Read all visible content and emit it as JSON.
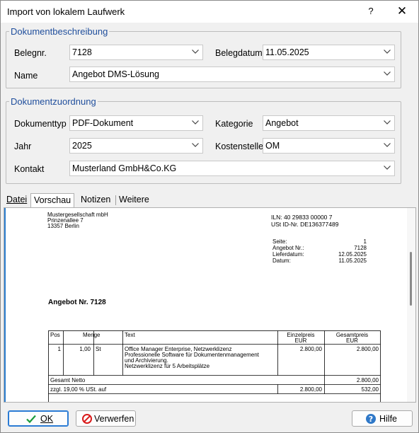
{
  "window": {
    "title": "Import von lokalem Laufwerk",
    "help_glyph": "?",
    "close_glyph": "✕"
  },
  "beschreibung": {
    "legend": "Dokumentbeschreibung",
    "belegnr_label": "Belegnr.",
    "belegnr_value": "7128",
    "belegdatum_label": "Belegdatum",
    "belegdatum_value": "11.05.2025",
    "name_label": "Name",
    "name_value": "Angebot DMS-Lösung"
  },
  "zuordnung": {
    "legend": "Dokumentzuordnung",
    "dokumenttyp_label": "Dokumenttyp",
    "dokumenttyp_value": "PDF-Dokument",
    "kategorie_label": "Kategorie",
    "kategorie_value": "Angebot",
    "jahr_label": "Jahr",
    "jahr_value": "2025",
    "kostenstelle_label": "Kostenstelle",
    "kostenstelle_value": "OM",
    "kontakt_label": "Kontakt",
    "kontakt_value": "Musterland GmbH&Co.KG"
  },
  "tabs": [
    {
      "label": "Datei"
    },
    {
      "label": "Vorschau"
    },
    {
      "label": "Notizen"
    },
    {
      "label": "Weitere"
    }
  ],
  "preview": {
    "sender_1": "Mustergesellschaft mbH",
    "sender_2": "Prinzenallee 7",
    "sender_3": "13357 Berlin",
    "iln": "ILN: 40 29833 00000 7",
    "ustid": "USt ID-Nr. DE136377489",
    "seite_label": "Seite:",
    "seite_value": "1",
    "angebotnr_label": "Angebot Nr.:",
    "angebotnr_value": "7128",
    "lieferdatum_label": "Lieferdatum:",
    "lieferdatum_value": "12.05.2025",
    "datum_label": "Datum:",
    "datum_value": "11.05.2025",
    "heading": "Angebot Nr. 7128",
    "col_pos": "Pos",
    "col_menge": "Menge",
    "col_text": "Text",
    "col_einzel_1": "Einzelpreis",
    "col_einzel_2": "EUR",
    "col_gesamt_1": "Gesamtpreis",
    "col_gesamt_2": "EUR",
    "row_pos": "1",
    "row_menge": "1,00",
    "row_unit": "St",
    "row_text_1": "Office Manager Enterprise, Netzwerklizenz",
    "row_text_2": "Professionelle Software für Dokumentenmanagement",
    "row_text_3": "und Archivierung.",
    "row_text_4": "Netzwerklizenz für 5 Arbeitsplätze",
    "row_einzel": "2.800,00",
    "row_gesamt": "2.800,00",
    "netto_label": "Gesamt Netto",
    "netto_value": "2.800,00",
    "ust_label": "zzgl. 19,00 % USt. auf",
    "ust_base": "2.800,00",
    "ust_value": "532,00"
  },
  "buttons": {
    "ok": "OK",
    "verwerfen": "Verwerfen",
    "hilfe": "Hilfe"
  }
}
